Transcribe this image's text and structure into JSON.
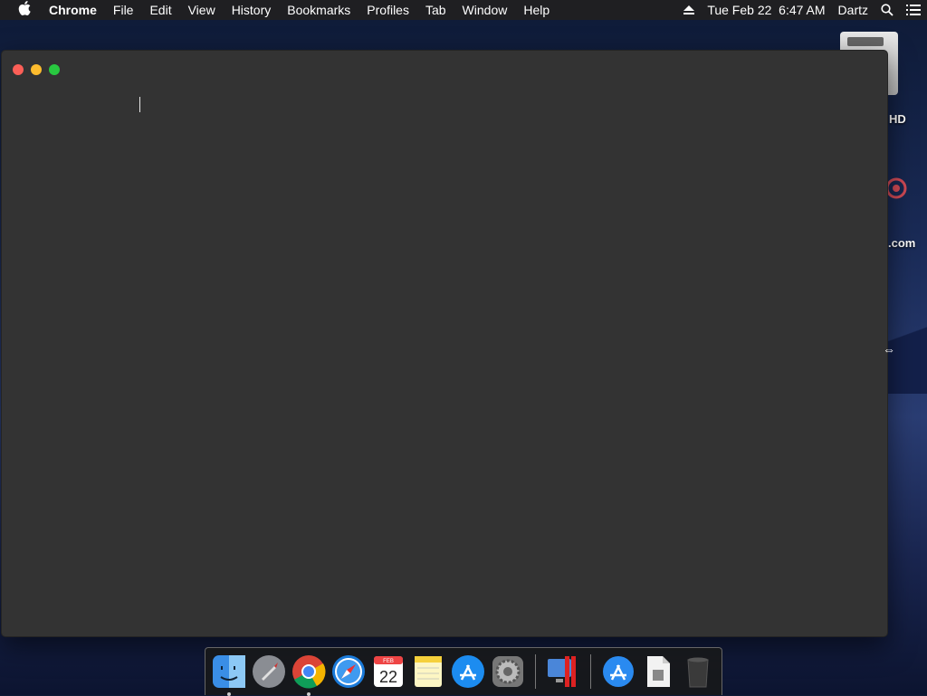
{
  "menubar": {
    "apple_icon": "apple-logo-icon",
    "app_name": "Chrome",
    "items": [
      "File",
      "Edit",
      "View",
      "History",
      "Bookmarks",
      "Profiles",
      "Tab",
      "Window",
      "Help"
    ],
    "datetime": "Tue Feb 22  6:47 AM",
    "user": "Dartz",
    "icons": [
      "eject-icon",
      "search-icon",
      "list-icon"
    ]
  },
  "desktop": {
    "hd_label": "HD",
    "web_label": ".com"
  },
  "window": {
    "controls": [
      "close",
      "minimize",
      "zoom"
    ],
    "content": ""
  },
  "dock": {
    "items": [
      "Finder",
      "Launchpad",
      "Google Chrome",
      "Safari",
      "Calendar",
      "Notes",
      "App Store",
      "System Preferences",
      "Parallels",
      "App Store Installer",
      "Document",
      "Trash"
    ],
    "calendar_month": "FEB",
    "calendar_day": "22"
  },
  "colors": {
    "menubar_bg": "#1f1f22",
    "window_bg": "#333333",
    "close": "#fc5f57",
    "minimize": "#fdbc2e",
    "zoom": "#28c840"
  }
}
